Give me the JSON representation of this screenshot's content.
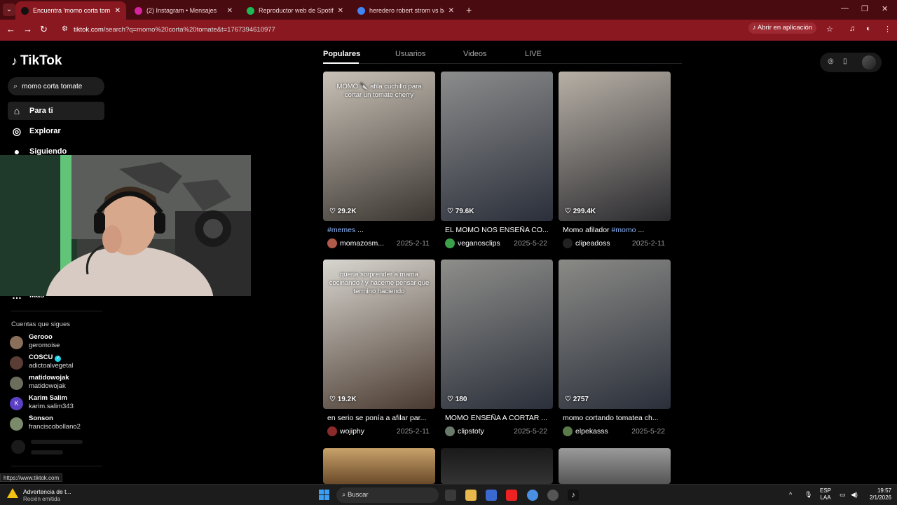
{
  "browser": {
    "tabs": [
      {
        "title": "Encuentra 'momo corta tom",
        "active": true,
        "color": "#111111"
      },
      {
        "title": "(2) Instagram • Mensajes",
        "active": false,
        "color": "#d6249f"
      },
      {
        "title": "Reproductor web de Spotify: m",
        "active": false,
        "color": "#1db954"
      },
      {
        "title": "heredero robert strom vs baule",
        "active": false,
        "color": "#4285f4"
      }
    ],
    "url_host": "tiktok.com",
    "url_rest": "/search?q=momo%20corta%20tomate&t=1767394610977",
    "open_in_app": "Abrir en aplicación"
  },
  "sidebar": {
    "logo": "TikTok",
    "search_value": "momo corta tomate",
    "nav": [
      {
        "label": "Para ti",
        "icon": "home-icon",
        "glyph": "⌂"
      },
      {
        "label": "Explorar",
        "icon": "compass-icon",
        "glyph": "◎"
      },
      {
        "label": "Siguiendo",
        "icon": "following-icon",
        "glyph": "●"
      },
      {
        "label": "Más",
        "icon": "more-icon",
        "glyph": "…"
      }
    ],
    "following_header": "Cuentas que sigues",
    "accounts": [
      {
        "name": "Gerooo",
        "handle": "geromoise",
        "color": "#8a6f5a",
        "verified": false,
        "initial": ""
      },
      {
        "name": "COSCU",
        "handle": "adictoalvegetal",
        "color": "#5a3d35",
        "verified": true,
        "initial": ""
      },
      {
        "name": "matidowojak",
        "handle": "matidowojak",
        "color": "#6d6d5d",
        "verified": false,
        "initial": ""
      },
      {
        "name": "Karim Salim",
        "handle": "karim.salim343",
        "color": "#5b3fc4",
        "verified": false,
        "initial": "K"
      },
      {
        "name": "Sonson",
        "handle": "franciscobollano2",
        "color": "#7b8a6a",
        "verified": false,
        "initial": ""
      }
    ]
  },
  "search_tabs": [
    "Populares",
    "Usuarios",
    "Videos",
    "LIVE"
  ],
  "videos": [
    {
      "likes": "29.2K",
      "caption_tag": "#memes",
      "caption": " ...",
      "user": "momazosm...",
      "date": "2025-2-11",
      "overlay": "MOMO 🔪 afila cuchillo para cortar un tomate cherry",
      "bg1": "#c9c2b8",
      "bg2": "#3a3530",
      "ucolor": "#b05a4a"
    },
    {
      "likes": "79.6K",
      "caption_tag": "",
      "caption": "EL MOMO NOS ENSEÑA CO...",
      "user": "veganosclips",
      "date": "2025-5-22",
      "overlay": "",
      "bg1": "#8c8c8c",
      "bg2": "#2a2f3a",
      "ucolor": "#3aa04a"
    },
    {
      "likes": "299.4K",
      "caption_tag": "#momo",
      "caption_pre": "Momo afilador ",
      "caption": " ...",
      "user": "clipeadoss",
      "date": "2025-2-11",
      "overlay": "",
      "bg1": "#b7b0a6",
      "bg2": "#2a2a2e",
      "ucolor": "#222222"
    },
    {
      "likes": "19.2K",
      "caption_tag": "",
      "caption": "en serio se ponía a afilar par...",
      "user": "wojiphy",
      "date": "2025-2-11",
      "overlay": "queria sorprender a mama cocinando / y haceme pensar que termino haciendo",
      "bg1": "#d8d6d0",
      "bg2": "#4a3a30",
      "ucolor": "#8a2a2a"
    },
    {
      "likes": "180",
      "caption_tag": "",
      "caption": "MOMO ENSEÑA A CORTAR ...",
      "user": "clipstoty",
      "date": "2025-5-22",
      "overlay": "",
      "bg1": "#8e8e8a",
      "bg2": "#2a2f3a",
      "ucolor": "#6a7a6a"
    },
    {
      "likes": "2757",
      "caption_tag": "",
      "caption": "momo cortando tomatea ch...",
      "user": "elpekasss",
      "date": "2025-5-22",
      "overlay": "",
      "bg1": "#8a8a86",
      "bg2": "#2a2f3a",
      "ucolor": "#5a7a4a"
    }
  ],
  "status_url": "https://www.tiktok.com",
  "taskbar": {
    "notif_title": "Advertencia de t...",
    "notif_sub": "Recién emitida",
    "search": "Buscar",
    "lang1": "ESP",
    "lang2": "LAA",
    "time": "19:57",
    "date": "2/1/2026"
  }
}
